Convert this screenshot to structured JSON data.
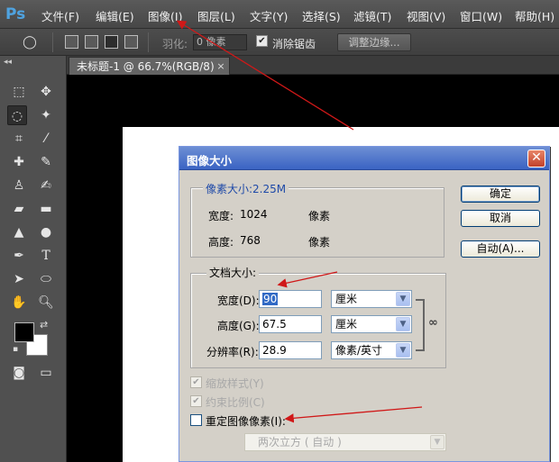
{
  "app": {
    "logo": "Ps"
  },
  "menu": [
    "文件(F)",
    "编辑(E)",
    "图像(I)",
    "图层(L)",
    "文字(Y)",
    "选择(S)",
    "滤镜(T)",
    "视图(V)",
    "窗口(W)",
    "帮助(H)"
  ],
  "options": {
    "feather_label": "羽化:",
    "feather_value": "0 像素",
    "antialias_label": "消除锯齿",
    "antialias_checked": true,
    "refine_edge": "调整边缘..."
  },
  "document_tab": {
    "title": "未标题-1 @ 66.7%(RGB/8)",
    "close": "×"
  },
  "toolbox_collapse": "◂◂",
  "colors": {
    "foreground": "#000000",
    "background": "#ffffff",
    "annotation_arrow": "#d01818"
  },
  "dialog": {
    "title": "图像大小",
    "pixel_dimensions": {
      "label": "像素大小:2.25M",
      "width_label": "宽度:",
      "width_value": "1024",
      "width_unit": "像素",
      "height_label": "高度:",
      "height_value": "768",
      "height_unit": "像素"
    },
    "document_size": {
      "label": "文档大小:",
      "width_label": "宽度(D):",
      "width_value": "90",
      "width_unit": "厘米",
      "height_label": "高度(G):",
      "height_value": "67.5",
      "height_unit": "厘米",
      "resolution_label": "分辨率(R):",
      "resolution_value": "28.9",
      "resolution_unit": "像素/英寸"
    },
    "buttons": {
      "ok": "确定",
      "cancel": "取消",
      "auto": "自动(A)..."
    },
    "scale_styles": "缩放样式(Y)",
    "constrain_proportions": "约束比例(C)",
    "resample": "重定图像像素(I):",
    "resample_method": "两次立方 ( 自动 )"
  }
}
